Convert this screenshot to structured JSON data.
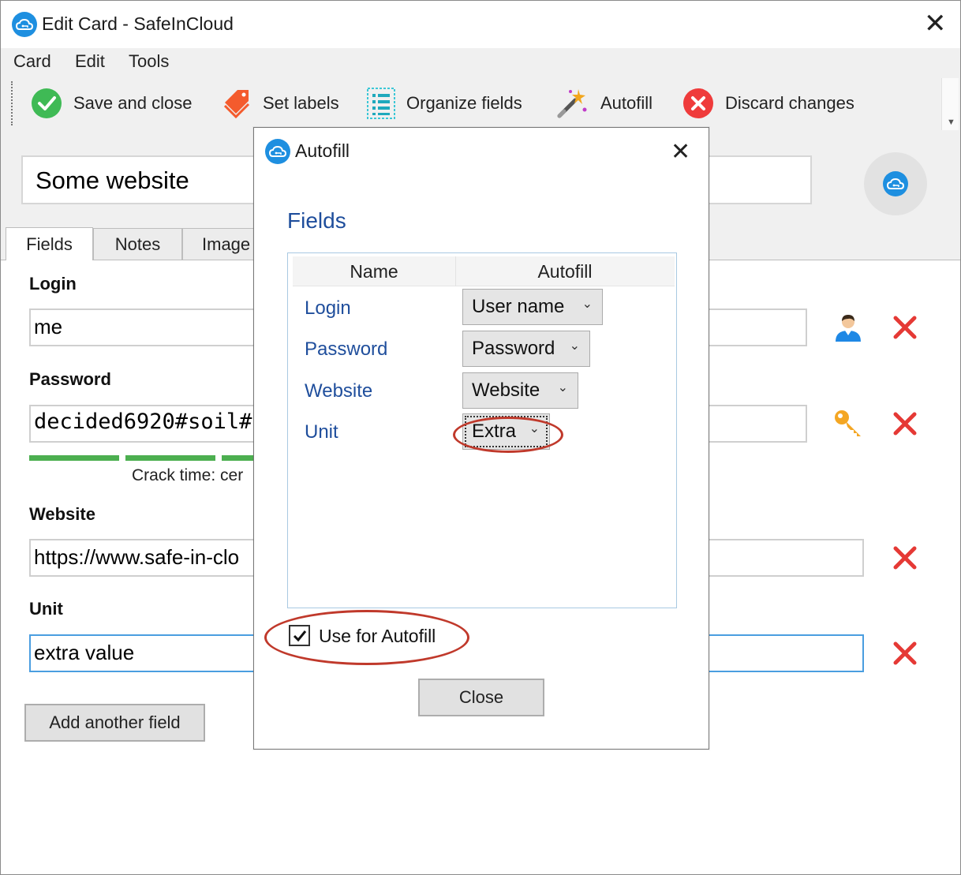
{
  "window": {
    "title": "Edit Card - SafeInCloud"
  },
  "menu": [
    "Card",
    "Edit",
    "Tools"
  ],
  "toolbar": {
    "save": "Save and close",
    "labels": "Set labels",
    "organize": "Organize fields",
    "autofill": "Autofill",
    "discard": "Discard changes"
  },
  "card": {
    "title": "Some website"
  },
  "tabs": [
    "Fields",
    "Notes",
    "Image"
  ],
  "fields": {
    "login": {
      "label": "Login",
      "value": "me"
    },
    "password": {
      "label": "Password",
      "value": "decided6920#soil#",
      "crack_time": "Crack time: cer"
    },
    "website": {
      "label": "Website",
      "value": "https://www.safe-in-clo"
    },
    "unit": {
      "label": "Unit",
      "value": "extra value"
    },
    "add_button": "Add another field"
  },
  "dialog": {
    "title": "Autofill",
    "heading": "Fields",
    "columns": [
      "Name",
      "Autofill"
    ],
    "rows": [
      {
        "name": "Login",
        "autofill": "User name"
      },
      {
        "name": "Password",
        "autofill": "Password"
      },
      {
        "name": "Website",
        "autofill": "Website"
      },
      {
        "name": "Unit",
        "autofill": "Extra"
      }
    ],
    "use_for_autofill": "Use for Autofill",
    "use_for_autofill_checked": true,
    "close_button": "Close"
  },
  "colors": {
    "accent": "#1e8fe0",
    "heading_blue": "#1f4e9c",
    "strength_green": "#4caf50",
    "delete_red": "#e53935",
    "annotation_red": "#c0392b"
  }
}
